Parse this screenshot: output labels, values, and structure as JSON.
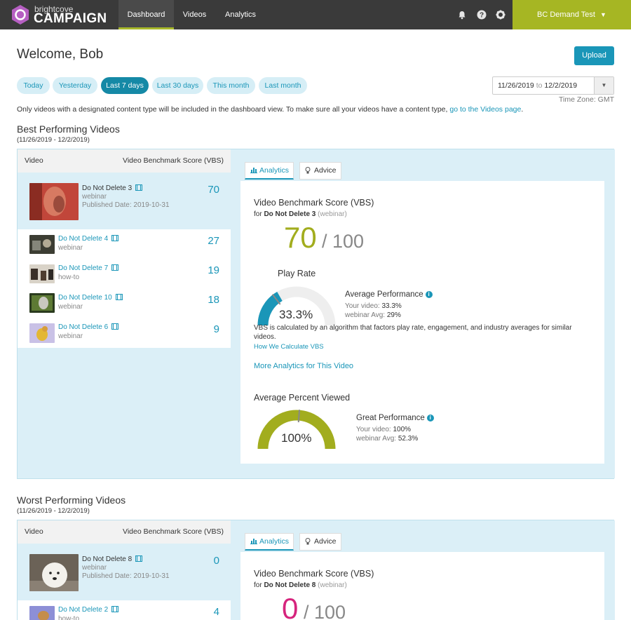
{
  "nav": {
    "brand_small": "brightcove",
    "brand_big": "CAMPAIGN",
    "tabs": [
      "Dashboard",
      "Videos",
      "Analytics"
    ],
    "account": "BC Demand Test",
    "accent": "#a6b623"
  },
  "header": {
    "welcome": "Welcome, Bob",
    "upload": "Upload"
  },
  "filters": {
    "pills": [
      "Today",
      "Yesterday",
      "Last 7 days",
      "Last 30 days",
      "This month",
      "Last month"
    ],
    "active": "Last 7 days",
    "date_from": "11/26/2019",
    "date_sep": "to",
    "date_to": "12/2/2019",
    "timezone": "Time Zone: GMT"
  },
  "notice": {
    "text": "Only videos with a designated content type will be included in the dashboard view. To make sure all your videos have a content type,",
    "link": "go to the Videos page",
    "tail": "."
  },
  "best": {
    "title": "Best Performing Videos",
    "range": "(11/26/2019 - 12/2/2019)",
    "col_video": "Video",
    "col_score": "Video Benchmark Score (VBS)",
    "videos": [
      {
        "title": "Do Not Delete 3",
        "type": "webinar",
        "published": "Published Date: 2019-10-31",
        "score": "70"
      },
      {
        "title": "Do Not Delete 4",
        "type": "webinar",
        "score": "27"
      },
      {
        "title": "Do Not Delete 7",
        "type": "how-to",
        "score": "19"
      },
      {
        "title": "Do Not Delete 10",
        "type": "webinar",
        "score": "18"
      },
      {
        "title": "Do Not Delete 6",
        "type": "webinar",
        "score": "9"
      }
    ],
    "tabs": [
      "Analytics",
      "Advice"
    ],
    "vbs_heading": "Video Benchmark Score (VBS)",
    "vbs_for": "for",
    "vbs_video": "Do Not Delete 3",
    "vbs_type": "(webinar)",
    "vbs_score": "70",
    "vbs_out_of": "/ 100",
    "score_color": "#a2ad1e",
    "play_rate": {
      "heading": "Play Rate",
      "value_label": "33.3%",
      "fraction": 0.333,
      "avg_fraction": 0.29,
      "perf": "Average Performance",
      "your_label": "Your video:",
      "your_value": "33.3%",
      "avg_label": "webinar Avg:",
      "avg_value": "29%"
    },
    "explain": "VBS is calculated by an algorithm that factors play rate, engagement, and industry averages for similar videos.",
    "how_link": "How We Calculate VBS",
    "more_link": "More Analytics for This Video",
    "viewed": {
      "heading": "Average Percent Viewed",
      "value_label": "100%",
      "fraction": 1.0,
      "avg_fraction": 0.523,
      "perf": "Great Performance",
      "your_label": "Your video:",
      "your_value": "100%",
      "avg_label": "webinar Avg:",
      "avg_value": "52.3%"
    }
  },
  "worst": {
    "title": "Worst Performing Videos",
    "range": "(11/26/2019 - 12/2/2019)",
    "col_video": "Video",
    "col_score": "Video Benchmark Score (VBS)",
    "videos": [
      {
        "title": "Do Not Delete 8",
        "type": "webinar",
        "published": "Published Date: 2019-10-31",
        "score": "0"
      },
      {
        "title": "Do Not Delete 2",
        "type": "how-to",
        "score": "4"
      }
    ],
    "tabs": [
      "Analytics",
      "Advice"
    ],
    "vbs_heading": "Video Benchmark Score (VBS)",
    "vbs_for": "for",
    "vbs_video": "Do Not Delete 8",
    "vbs_type": "(webinar)",
    "vbs_score": "0",
    "vbs_out_of": "/ 100",
    "score_color": "#d6247d"
  }
}
